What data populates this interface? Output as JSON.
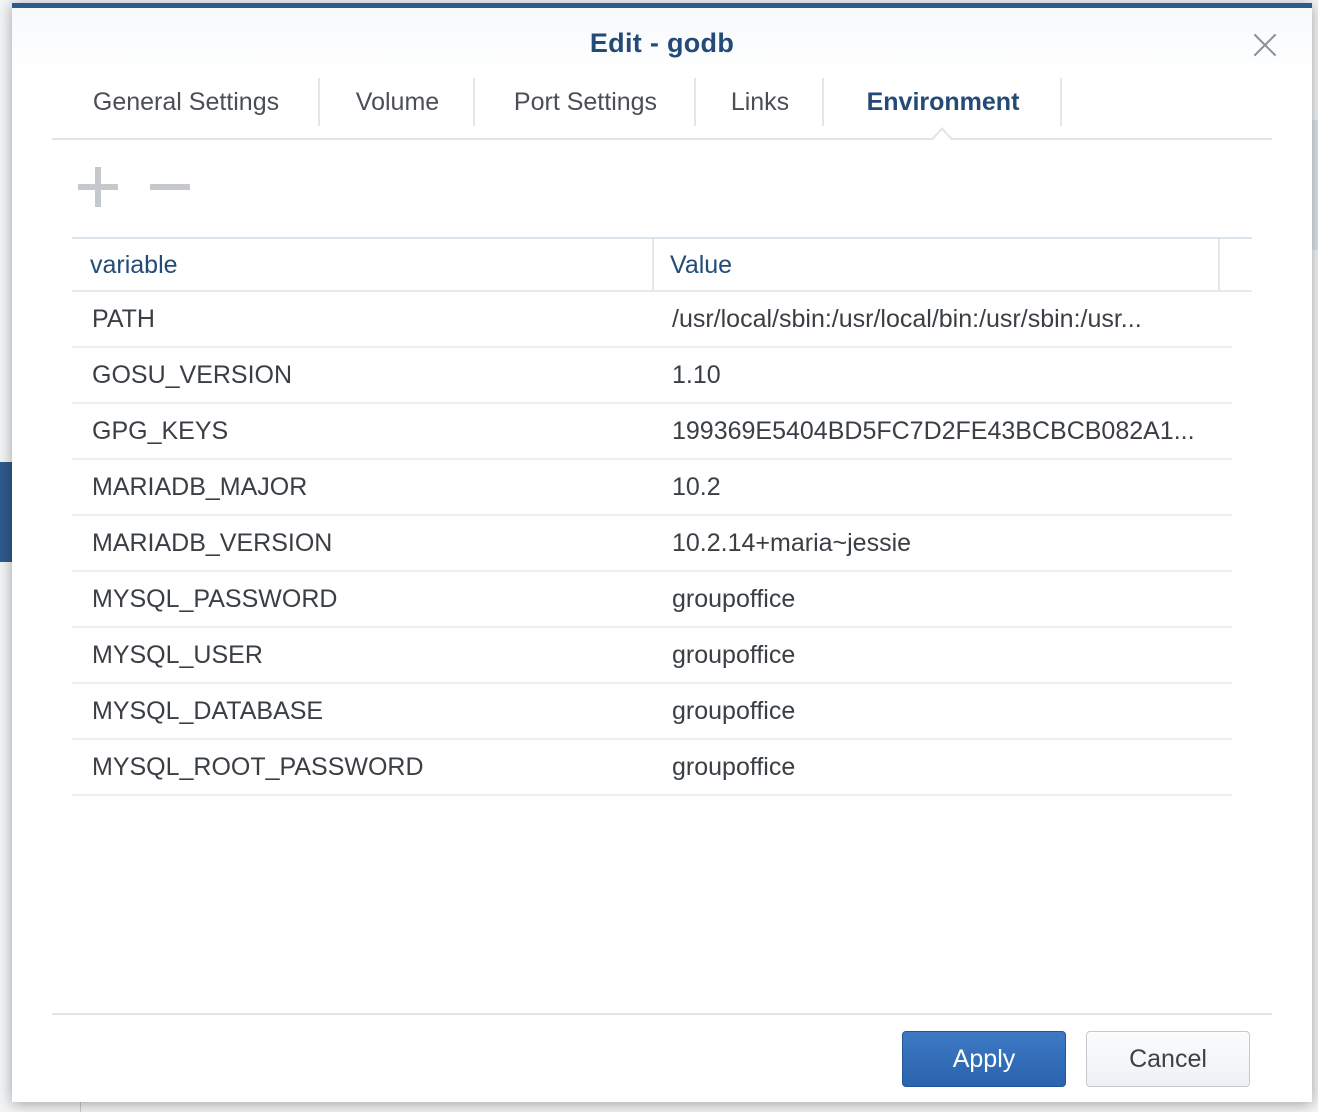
{
  "dialog": {
    "title": "Edit - godb",
    "close_icon": "close-icon"
  },
  "tabs": [
    {
      "label": "General Settings",
      "active": false
    },
    {
      "label": "Volume",
      "active": false
    },
    {
      "label": "Port Settings",
      "active": false
    },
    {
      "label": "Links",
      "active": false
    },
    {
      "label": "Environment",
      "active": true
    }
  ],
  "toolbar": {
    "add_icon": "plus-icon",
    "remove_icon": "minus-icon"
  },
  "grid": {
    "columns": [
      "variable",
      "Value"
    ],
    "rows": [
      {
        "variable": "PATH",
        "value": "/usr/local/sbin:/usr/local/bin:/usr/sbin:/usr..."
      },
      {
        "variable": "GOSU_VERSION",
        "value": "1.10"
      },
      {
        "variable": "GPG_KEYS",
        "value": "199369E5404BD5FC7D2FE43BCBCB082A1..."
      },
      {
        "variable": "MARIADB_MAJOR",
        "value": "10.2"
      },
      {
        "variable": "MARIADB_VERSION",
        "value": "10.2.14+maria~jessie"
      },
      {
        "variable": "MYSQL_PASSWORD",
        "value": "groupoffice"
      },
      {
        "variable": "MYSQL_USER",
        "value": "groupoffice"
      },
      {
        "variable": "MYSQL_DATABASE",
        "value": "groupoffice"
      },
      {
        "variable": "MYSQL_ROOT_PASSWORD",
        "value": "groupoffice"
      }
    ]
  },
  "footer": {
    "apply_label": "Apply",
    "cancel_label": "Cancel"
  },
  "colors": {
    "accent": "#2f5a8e",
    "title": "#244a78",
    "primary_button": "#2a63ae"
  }
}
